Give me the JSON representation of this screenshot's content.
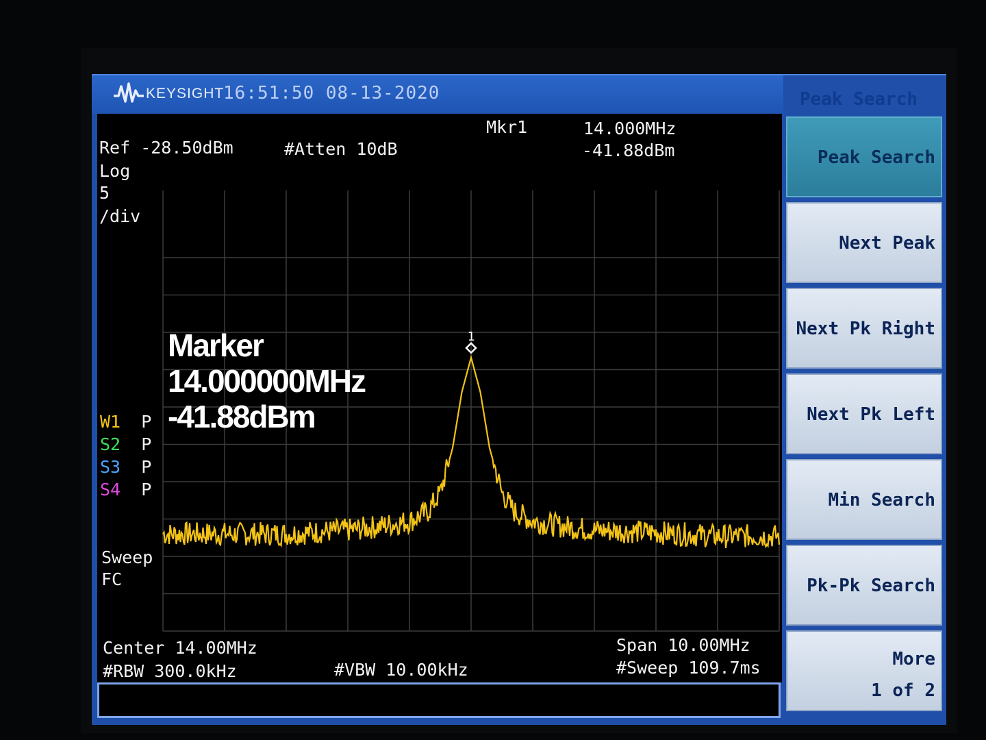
{
  "header": {
    "brand": "KEYSIGHT",
    "datetime": "16:51:50 08-13-2020",
    "menu_title": "Peak Search"
  },
  "settings": {
    "ref": "Ref -28.50dBm",
    "atten": "#Atten 10dB",
    "scale_type": "Log",
    "scale_value": "5",
    "scale_unit": "/div",
    "marker_label": "Mkr1",
    "marker_freq": "14.000MHz",
    "marker_amp": "-41.88dBm",
    "sweep_label": "Sweep",
    "sweep_mode": "FC",
    "center": "Center 14.00MHz",
    "rbw": "#RBW 300.0kHz",
    "vbw": "#VBW 10.00kHz",
    "span": "Span 10.00MHz",
    "sweep_time": "#Sweep 109.7ms"
  },
  "traces": [
    {
      "id": "W1",
      "mode": "P",
      "color": "#f3c316"
    },
    {
      "id": "S2",
      "mode": "P",
      "color": "#3fe05a"
    },
    {
      "id": "S3",
      "mode": "P",
      "color": "#4aa6ff"
    },
    {
      "id": "S4",
      "mode": "P",
      "color": "#e04ae0"
    }
  ],
  "marker_readout": {
    "title": "Marker",
    "freq": "14.000000MHz",
    "amp": "-41.88dBm",
    "marker_number": "1"
  },
  "softkeys": [
    {
      "label": "Peak Search",
      "active": true
    },
    {
      "label": "Next Peak"
    },
    {
      "label": "Next Pk Right"
    },
    {
      "label": "Next Pk Left"
    },
    {
      "label": "Min Search"
    },
    {
      "label": "Pk-Pk Search"
    },
    {
      "label": "More",
      "sublabel": "1 of 2"
    }
  ],
  "chart_data": {
    "type": "line",
    "x_center_mhz": 14.0,
    "x_span_mhz": 10.0,
    "xlim": [
      9.0,
      19.0
    ],
    "ref_level_dbm": -28.5,
    "db_per_div": 5,
    "ylim": [
      -78.5,
      -28.5
    ],
    "grid": true,
    "series": [
      {
        "color": "#f3c316",
        "x": [
          9.0,
          10.0,
          11.0,
          12.0,
          12.5,
          13.0,
          13.3,
          13.5,
          13.7,
          13.85,
          14.0,
          14.15,
          14.3,
          14.5,
          14.7,
          15.0,
          15.5,
          16.0,
          17.0,
          18.0,
          19.0
        ],
        "y": [
          -65.5,
          -65.5,
          -65.5,
          -65.0,
          -64.5,
          -63.8,
          -62.5,
          -60.0,
          -54.0,
          -46.5,
          -41.88,
          -46.5,
          -54.0,
          -60.0,
          -62.5,
          -63.8,
          -64.5,
          -65.0,
          -65.3,
          -65.8,
          -65.8
        ]
      }
    ]
  }
}
